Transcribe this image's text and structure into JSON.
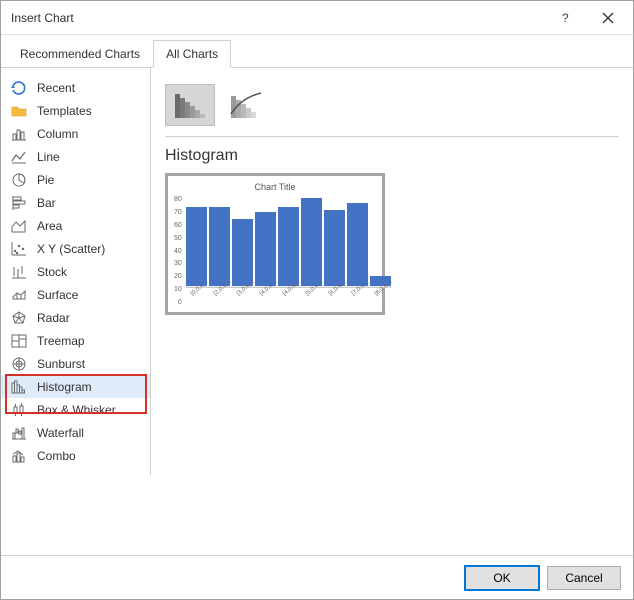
{
  "dialog": {
    "title": "Insert Chart"
  },
  "tabs": {
    "recommended": "Recommended Charts",
    "all": "All Charts",
    "active": "all"
  },
  "sidebar": {
    "items": [
      {
        "label": "Recent"
      },
      {
        "label": "Templates"
      },
      {
        "label": "Column"
      },
      {
        "label": "Line"
      },
      {
        "label": "Pie"
      },
      {
        "label": "Bar"
      },
      {
        "label": "Area"
      },
      {
        "label": "X Y (Scatter)"
      },
      {
        "label": "Stock"
      },
      {
        "label": "Surface"
      },
      {
        "label": "Radar"
      },
      {
        "label": "Treemap"
      },
      {
        "label": "Sunburst"
      },
      {
        "label": "Histogram"
      },
      {
        "label": "Box & Whisker"
      },
      {
        "label": "Waterfall"
      },
      {
        "label": "Combo"
      }
    ],
    "selected_index": 13
  },
  "main": {
    "type_label": "Histogram",
    "preview_title": "Chart Title"
  },
  "chart_data": {
    "type": "bar",
    "title": "Chart Title",
    "categories": [
      "[0,0.4…",
      "[2,0.4…",
      "[3,0.4…",
      "[4,0.4…",
      "[4,0.4…",
      "[5,0.4…",
      "[6,0.4…",
      "[7,0.4…",
      "[8,0.4…"
    ],
    "values": [
      70,
      70,
      60,
      66,
      70,
      78,
      68,
      74,
      10
    ],
    "xlabel": "",
    "ylabel": "",
    "ylim": [
      0,
      80
    ],
    "yticks": [
      0,
      10,
      20,
      30,
      40,
      50,
      60,
      70,
      80
    ]
  },
  "footer": {
    "ok": "OK",
    "cancel": "Cancel"
  },
  "colors": {
    "accent": "#4472c4",
    "highlight": "#d93025"
  }
}
